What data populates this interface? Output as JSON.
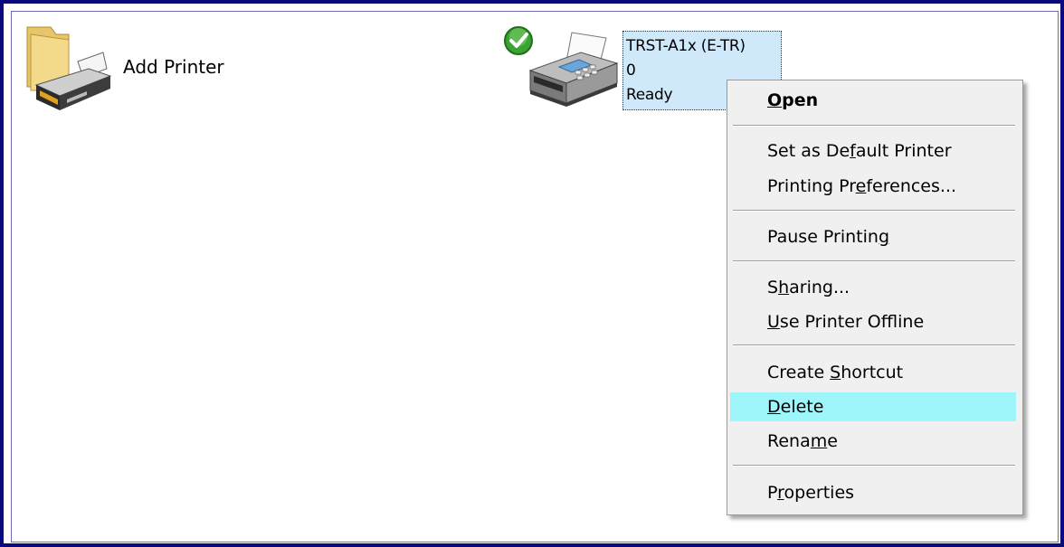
{
  "add_printer": {
    "label": "Add Printer",
    "icon": "add-printer-icon"
  },
  "printer": {
    "name": "TRST-A1x (E-TR)",
    "jobs": "0",
    "status": "Ready",
    "default_badge": "check-icon"
  },
  "menu": {
    "items": [
      {
        "label": "Open",
        "pre": "",
        "u": "O",
        "post": "pen",
        "bold": true
      },
      {
        "label": "Set as Default Printer",
        "pre": "Set as De",
        "u": "f",
        "post": "ault Printer"
      },
      {
        "label": "Printing Preferences...",
        "pre": "Printing Pr",
        "u": "e",
        "post": "ferences..."
      },
      {
        "label": "Pause Printing",
        "pre": "Pause Printin",
        "u": "g",
        "post": ""
      },
      {
        "label": "Sharing...",
        "pre": "S",
        "u": "h",
        "post": "aring..."
      },
      {
        "label": "Use Printer Offline",
        "pre": "",
        "u": "U",
        "post": "se Printer Offline"
      },
      {
        "label": "Create Shortcut",
        "pre": "Create ",
        "u": "S",
        "post": "hortcut"
      },
      {
        "label": "Delete",
        "pre": "",
        "u": "D",
        "post": "elete",
        "highlighted": true
      },
      {
        "label": "Rename",
        "pre": "Rena",
        "u": "m",
        "post": "e"
      },
      {
        "label": "Properties",
        "pre": "P",
        "u": "r",
        "post": "operties"
      }
    ]
  },
  "colors": {
    "frame_border": "#0a0a80",
    "selection_bg": "#cfe9fb",
    "menu_highlight": "#9ef6fb",
    "menu_bg": "#f0f0f0"
  }
}
